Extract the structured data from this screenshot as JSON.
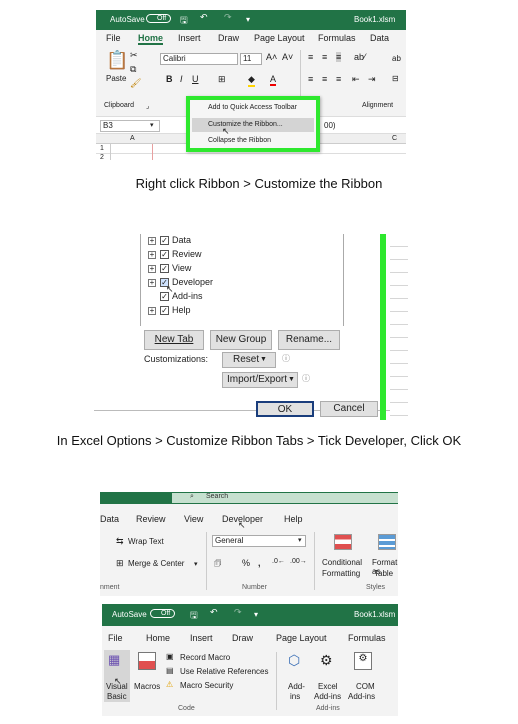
{
  "s1": {
    "autosave": "AutoSave",
    "toggle": "Off",
    "book": "Book1.xlsm",
    "tabs": [
      "File",
      "Home",
      "Insert",
      "Draw",
      "Page Layout",
      "Formulas",
      "Data"
    ],
    "paste": "Paste",
    "font": "Calibri",
    "size": "11",
    "clipboard": "Clipboard",
    "alignment": "Alignment",
    "namebox": "B3",
    "formula": "00)",
    "col_a": "A",
    "col_c": "C",
    "rows": [
      "1",
      "2"
    ],
    "menu": [
      "Add to Quick Access Toolbar",
      "Customize the Ribbon...",
      "Collapse the Ribbon"
    ],
    "highlight": "#2ee82e"
  },
  "cap1": "Right click Ribbon > Customize the Ribbon",
  "s2": {
    "items": [
      "Data",
      "Review",
      "View",
      "Developer",
      "Add-ins",
      "Help"
    ],
    "new_tab": "New Tab",
    "new_group": "New Group",
    "rename": "Rename...",
    "customizations": "Customizations:",
    "reset": "Reset",
    "import_export": "Import/Export",
    "ok": "OK",
    "cancel": "Cancel"
  },
  "cap2": "In Excel Options > Customize Ribbon Tabs > Tick Developer, Click OK",
  "s3": {
    "search": "Search",
    "tabs": [
      "Data",
      "Review",
      "View",
      "Developer",
      "Help"
    ],
    "wrap": "Wrap Text",
    "merge": "Merge & Center",
    "format": "General",
    "percent": "%",
    "cond1": "Conditional",
    "cond2": "Formatting",
    "fmt1": "Format as",
    "fmt2": "Table",
    "alignment": "nment",
    "number": "Number",
    "styles": "Styles"
  },
  "s4": {
    "autosave": "AutoSave",
    "toggle": "Off",
    "book": "Book1.xlsm",
    "tabs": [
      "File",
      "Home",
      "Insert",
      "Draw",
      "Page Layout",
      "Formulas"
    ],
    "vb1": "Visual",
    "vb2": "Basic",
    "macros": "Macros",
    "record": "Record Macro",
    "relative": "Use Relative References",
    "security": "Macro Security",
    "code": "Code",
    "addins1": "Add-",
    "addins2": "ins",
    "excel1": "Excel",
    "excel2": "Add-ins",
    "com1": "COM",
    "com2": "Add-ins",
    "addins_group": "Add-ins"
  }
}
